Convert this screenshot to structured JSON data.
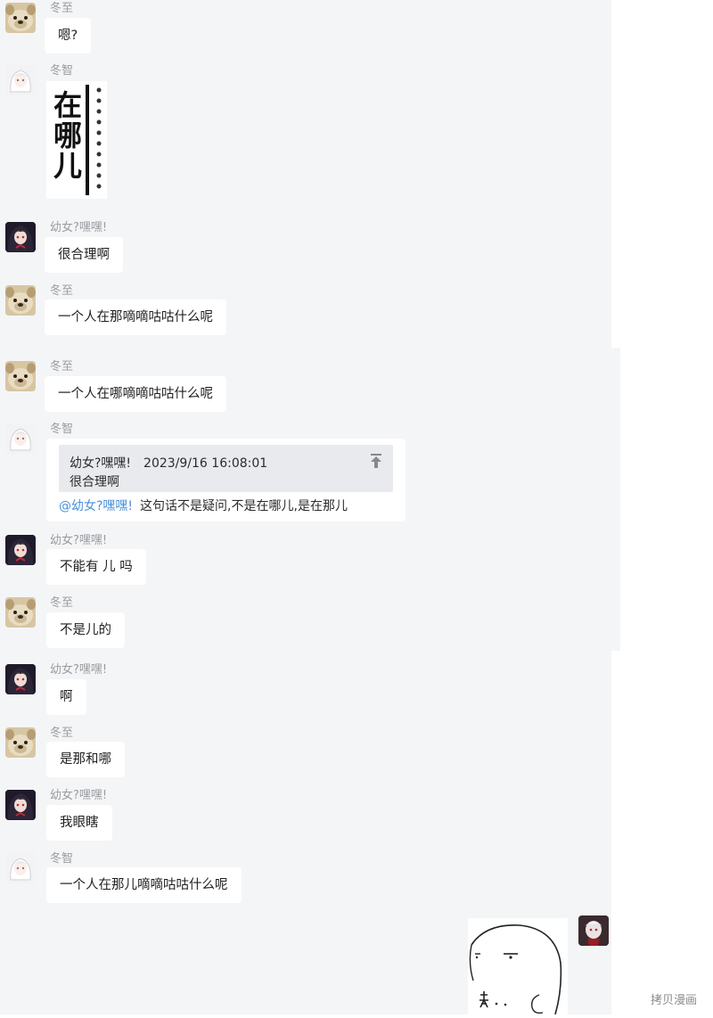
{
  "messages": [
    {
      "sender": "冬至",
      "text": "嗯?"
    },
    {
      "sender": "冬智",
      "sticker_text": "在哪儿"
    },
    {
      "sender": "幼女?嘿嘿!",
      "text": "很合理啊"
    },
    {
      "sender": "冬至",
      "text": "一个人在那嘀嘀咕咕什么呢"
    },
    {
      "sender": "冬至",
      "text": "一个人在哪嘀嘀咕咕什么呢"
    },
    {
      "sender": "冬智",
      "quote": {
        "author": "幼女?嘿嘿!",
        "time": "2023/9/16 16:08:01",
        "text": "很合理啊"
      },
      "mention": "@幼女?嘿嘿!",
      "text": "这句话不是疑问,不是在哪儿,是在那儿"
    },
    {
      "sender": "幼女?嘿嘿!",
      "text": "不能有 儿 吗"
    },
    {
      "sender": "冬至",
      "text": "不是儿的"
    },
    {
      "sender": "幼女?嘿嘿!",
      "text": "啊"
    },
    {
      "sender": "冬至",
      "text": "是那和哪"
    },
    {
      "sender": "幼女?嘿嘿!",
      "text": "我眼瞎"
    },
    {
      "sender": "冬智",
      "text": "一个人在那儿嘀嘀咕咕什么呢"
    },
    {
      "sender": "self",
      "sticker_text": "窥.."
    }
  ],
  "icons": [
    "avatar-dog",
    "avatar-girl-white",
    "avatar-girl-dark",
    "avatar-self",
    "pin-top-icon"
  ],
  "colors": {
    "background": "#f4f5f7",
    "bubble": "#ffffff",
    "mention": "#4a90d9",
    "sender": "#9a9ca1"
  },
  "watermark": "拷贝漫画"
}
